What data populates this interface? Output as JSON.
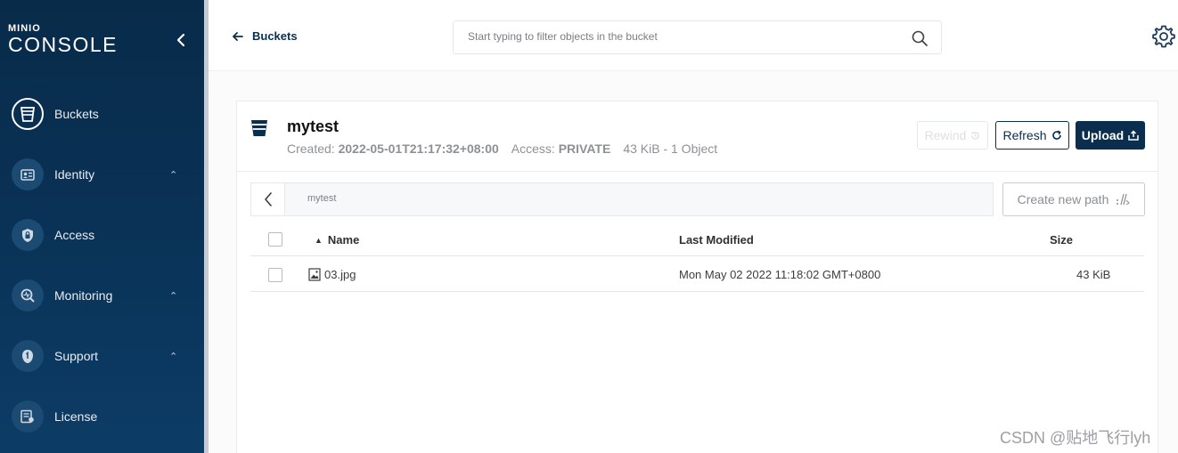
{
  "sidebar": {
    "logo_top": "MINIO",
    "logo_main": "CONSOLE",
    "collapse_glyph": "‹",
    "items": [
      {
        "label": "Buckets",
        "icon": "bucket-icon",
        "expandable": false
      },
      {
        "label": "Identity",
        "icon": "identity-card-icon",
        "expandable": true
      },
      {
        "label": "Access",
        "icon": "lock-shield-icon",
        "expandable": false
      },
      {
        "label": "Monitoring",
        "icon": "monitoring-icon",
        "expandable": true
      },
      {
        "label": "Support",
        "icon": "support-icon",
        "expandable": true
      },
      {
        "label": "License",
        "icon": "license-icon",
        "expandable": false
      }
    ],
    "caret_glyph": "⌃"
  },
  "topbar": {
    "back_label": "Buckets",
    "search_placeholder": "Start typing to filter objects in the bucket"
  },
  "bucket": {
    "name": "mytest",
    "created_label": "Created:",
    "created_value": "2022-05-01T21:17:32+08:00",
    "access_label": "Access:",
    "access_value": "PRIVATE",
    "usage": "43 KiB - 1 Object"
  },
  "actions": {
    "rewind_label": "Rewind",
    "refresh_label": "Refresh",
    "upload_label": "Upload",
    "create_path_label": "Create new path"
  },
  "breadcrumb": {
    "path": "mytest"
  },
  "table": {
    "columns": {
      "name": "Name",
      "last_modified": "Last Modified",
      "size": "Size"
    },
    "sort_indicator": "▲",
    "rows": [
      {
        "name": "03.jpg",
        "last_modified": "Mon May 02 2022 11:18:02 GMT+0800",
        "size": "43 KiB"
      }
    ]
  },
  "watermark": "CSDN @贴地飞行lyh",
  "colors": {
    "sidebar": "#0a3358",
    "primary": "#0b2e4e",
    "muted_text": "#8d9196"
  }
}
